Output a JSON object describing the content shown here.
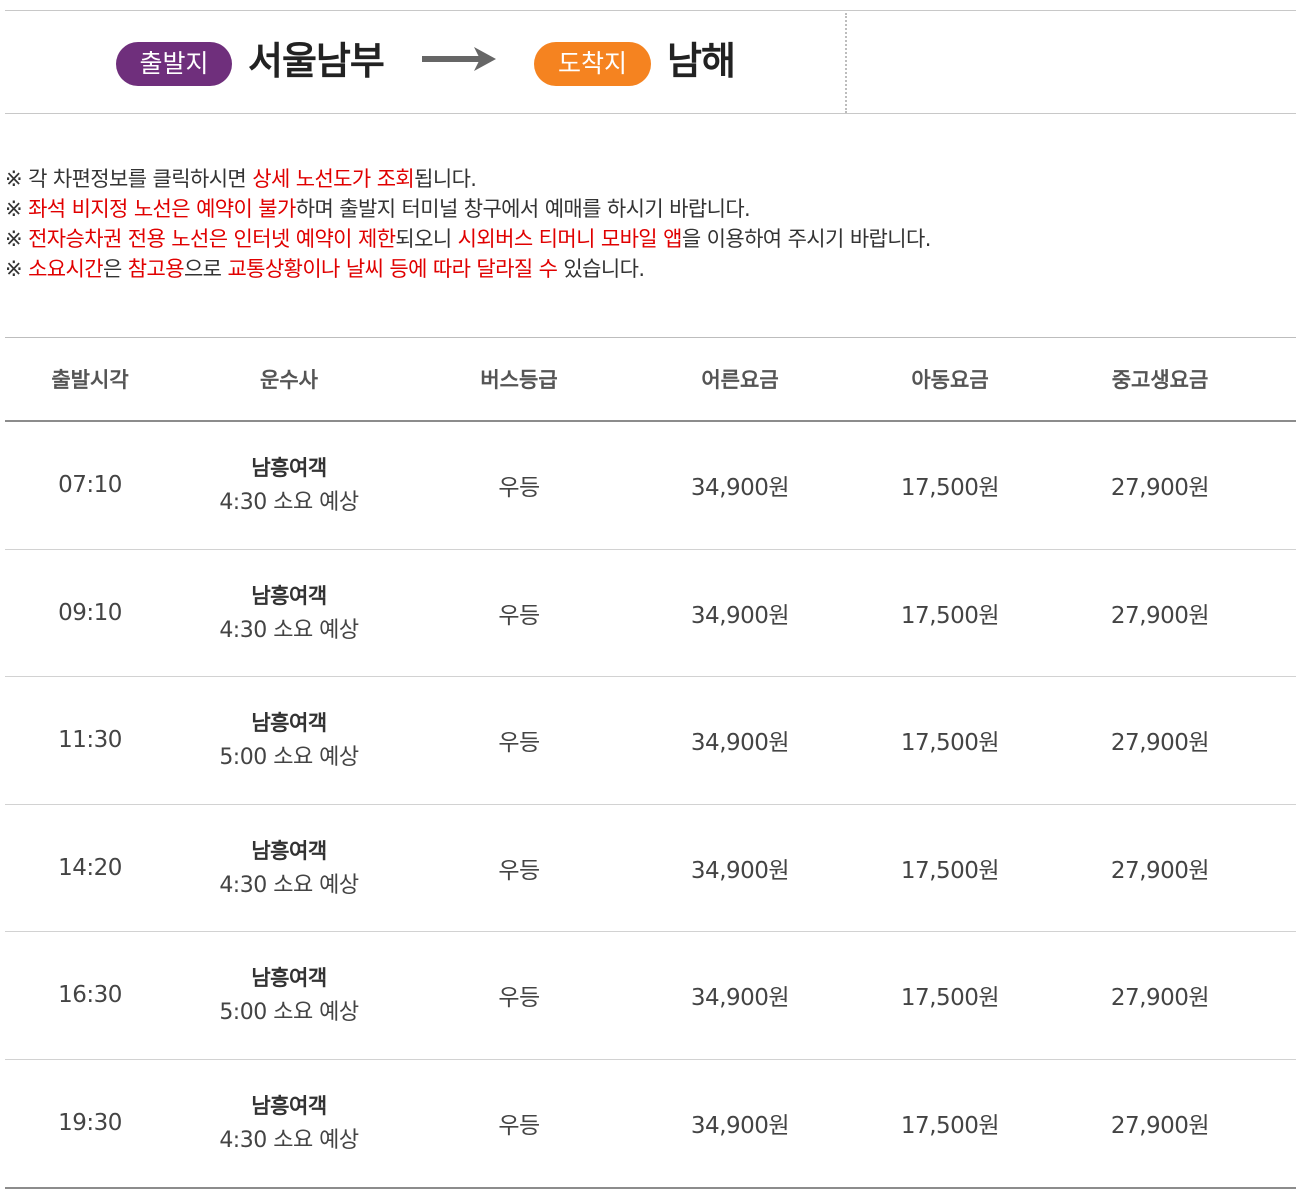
{
  "route": {
    "departure_label": "출발지",
    "departure_terminal": "서울남부",
    "arrival_label": "도착지",
    "arrival_terminal": "남해",
    "departure_color": "#6f2f7c",
    "arrival_color": "#f58320"
  },
  "notices": [
    {
      "parts": [
        {
          "text": "※ 각 차편정보를 클릭하시면 ",
          "hl": false
        },
        {
          "text": "상세 노선도가 조회",
          "hl": true
        },
        {
          "text": "됩니다.",
          "hl": false
        }
      ]
    },
    {
      "parts": [
        {
          "text": "※ ",
          "hl": false
        },
        {
          "text": "좌석 비지정 노선은 예약이 불가",
          "hl": true
        },
        {
          "text": "하며 출발지 터미널 창구에서 예매를 하시기 바랍니다.",
          "hl": false
        }
      ]
    },
    {
      "parts": [
        {
          "text": "※ ",
          "hl": false
        },
        {
          "text": "전자승차권 전용 노선은 인터넷 예약이 제한",
          "hl": true
        },
        {
          "text": "되오니 ",
          "hl": false
        },
        {
          "text": "시외버스 티머니 모바일 앱",
          "hl": true
        },
        {
          "text": "을 이용하여 주시기 바랍니다.",
          "hl": false
        }
      ]
    },
    {
      "parts": [
        {
          "text": "※ ",
          "hl": false
        },
        {
          "text": "소요시간",
          "hl": true
        },
        {
          "text": "은 ",
          "hl": false
        },
        {
          "text": "참고용",
          "hl": true
        },
        {
          "text": "으로 ",
          "hl": false
        },
        {
          "text": "교통상황이나 날씨 등에 따라 달라질 수",
          "hl": true
        },
        {
          "text": " 있습니다.",
          "hl": false
        }
      ]
    }
  ],
  "highlight_color": "#e00000",
  "table": {
    "headers": [
      "출발시각",
      "운수사",
      "버스등급",
      "어른요금",
      "아동요금",
      "중고생요금"
    ],
    "rows": [
      {
        "time": "07:10",
        "company": "남흥여객",
        "duration": "4:30 소요 예상",
        "grade": "우등",
        "adult": "34,900원",
        "child": "17,500원",
        "student": "27,900원"
      },
      {
        "time": "09:10",
        "company": "남흥여객",
        "duration": "4:30 소요 예상",
        "grade": "우등",
        "adult": "34,900원",
        "child": "17,500원",
        "student": "27,900원"
      },
      {
        "time": "11:30",
        "company": "남흥여객",
        "duration": "5:00 소요 예상",
        "grade": "우등",
        "adult": "34,900원",
        "child": "17,500원",
        "student": "27,900원"
      },
      {
        "time": "14:20",
        "company": "남흥여객",
        "duration": "4:30 소요 예상",
        "grade": "우등",
        "adult": "34,900원",
        "child": "17,500원",
        "student": "27,900원"
      },
      {
        "time": "16:30",
        "company": "남흥여객",
        "duration": "5:00 소요 예상",
        "grade": "우등",
        "adult": "34,900원",
        "child": "17,500원",
        "student": "27,900원"
      },
      {
        "time": "19:30",
        "company": "남흥여객",
        "duration": "4:30 소요 예상",
        "grade": "우등",
        "adult": "34,900원",
        "child": "17,500원",
        "student": "27,900원"
      }
    ]
  }
}
